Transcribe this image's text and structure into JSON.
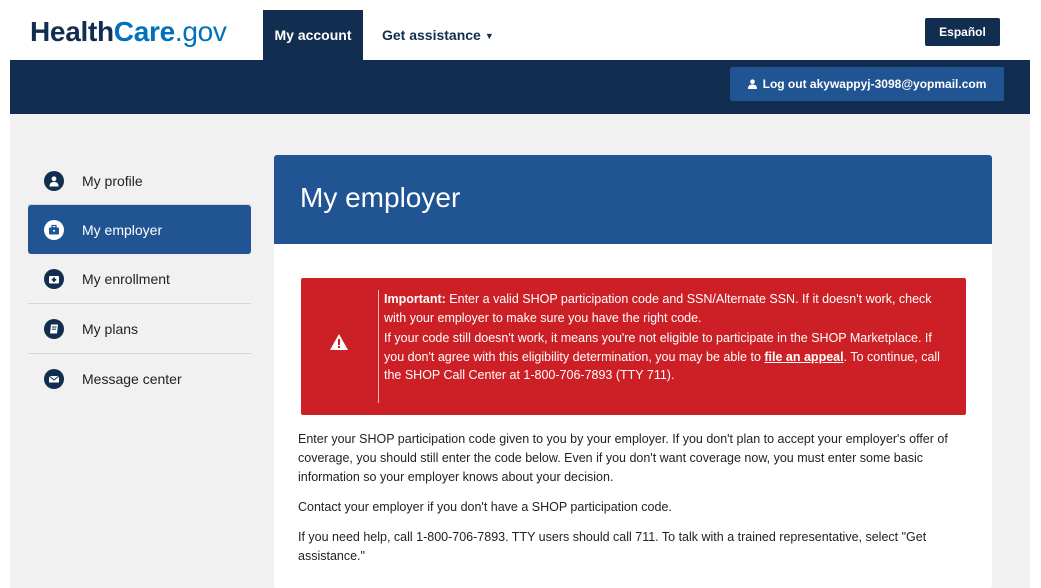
{
  "header": {
    "logo_part1": "Health",
    "logo_part2": "Care",
    "logo_part3": ".gov",
    "nav_my_account": "My account",
    "nav_get_assistance": "Get assistance",
    "espanol_label": "Español",
    "logout_label": "Log out akywappyj-3098@yopmail.com"
  },
  "sidebar": {
    "items": [
      {
        "label": "My profile",
        "icon": "user-icon",
        "active": false
      },
      {
        "label": "My employer",
        "icon": "briefcase-icon",
        "active": true
      },
      {
        "label": "My enrollment",
        "icon": "medical-kit-icon",
        "active": false
      },
      {
        "label": "My plans",
        "icon": "plans-icon",
        "active": false
      },
      {
        "label": "Message center",
        "icon": "envelope-icon",
        "active": false
      }
    ]
  },
  "main": {
    "title": "My employer",
    "alert": {
      "icon": "warning-icon",
      "lead": "Important:",
      "p1": "Enter a valid SHOP participation code and SSN/Alternate SSN. If it doesn't work, check with your employer to make sure you have the right code.",
      "p2_before": "If your code still doesn't work, it means you're not eligible to participate in the SHOP Marketplace. If you don't agree with this eligibility determination, you may be able to",
      "p2_link": "file an appeal",
      "p2_after": ". To continue, call the SHOP Call Center at 1-800-706-7893 (TTY 711)."
    },
    "paragraphs": [
      "Enter your SHOP participation code given to you by your employer. If you don't plan to accept your employer's offer of coverage, you should still enter the code below. Even if you don't want coverage now, you must enter some basic information so your employer knows about your decision.",
      "Contact your employer if you don't have a SHOP participation code.",
      "If you need help, call 1-800-706-7893. TTY users should call 711. To talk with a trained representative, select \"Get assistance.\""
    ]
  },
  "colors": {
    "navy": "#112e51",
    "blue": "#205493",
    "alert_red": "#cd2026",
    "page_bg": "#f1f1f1"
  }
}
